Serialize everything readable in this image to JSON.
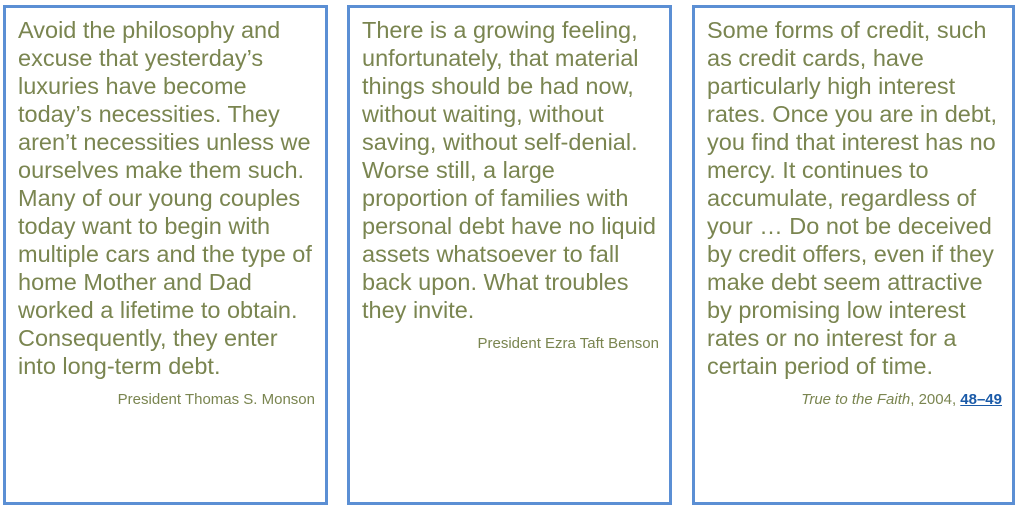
{
  "cards": [
    {
      "quote": "Avoid the philosophy and excuse that yesterday’s luxuries have become today’s necessities. They aren’t necessities unless we ourselves make them such. Many of our young couples today want to begin with multiple cars and the type of home Mother and Dad worked a lifetime to obtain. Consequently, they enter into long-term debt.",
      "attribution": "President Thomas S. Monson"
    },
    {
      "quote": "There is a growing feeling, unfortunately, that material things should be had now, without waiting, without saving, without self-denial. Worse still, a large proportion of families with personal debt have no liquid assets whatsoever to fall back upon. What troubles they invite.",
      "attribution": "President Ezra Taft Benson"
    },
    {
      "quote": "Some forms of credit, such as credit cards, have particularly high interest rates. Once you are in debt, you find that interest has no mercy. It continues to accumulate, regardless of your … Do not be deceived by credit offers, even if they make debt seem attractive by promising low interest rates or no interest for a certain period of time.",
      "source_title": "True to the Faith",
      "source_year": ", 2004, ",
      "source_pages": "48–49"
    }
  ],
  "colors": {
    "border": "#5b8fd4",
    "text": "#7a8550",
    "link": "#1a5aa8"
  }
}
